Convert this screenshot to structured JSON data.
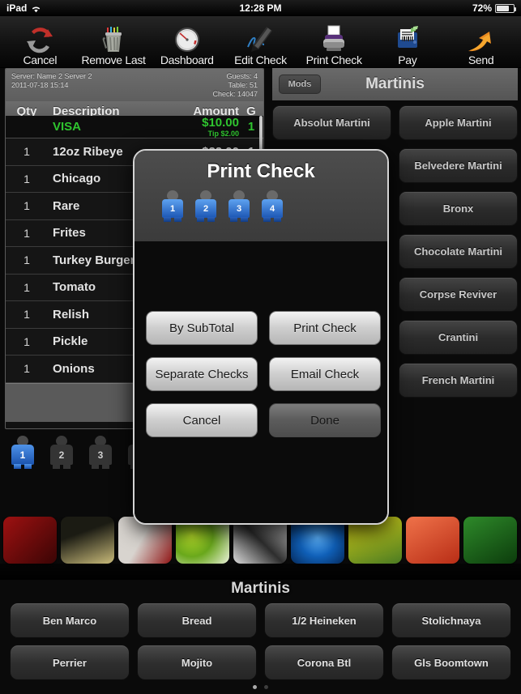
{
  "statusbar": {
    "device": "iPad",
    "wifi_icon": "wifi-icon",
    "time": "12:28 PM",
    "battery_percent": "72%",
    "battery_icon": "battery-icon"
  },
  "toolbar": {
    "items": [
      {
        "label": "Cancel",
        "icon": "cancel-refresh-icon"
      },
      {
        "label": "Remove Last",
        "icon": "trash-can-icon"
      },
      {
        "label": "Dashboard",
        "icon": "gauge-icon"
      },
      {
        "label": "Edit Check",
        "icon": "pen-signature-icon"
      },
      {
        "label": "Print Check",
        "icon": "printer-icon"
      },
      {
        "label": "Pay",
        "icon": "cash-register-icon"
      },
      {
        "label": "Send",
        "icon": "orange-arrow-icon"
      }
    ]
  },
  "check": {
    "server_line": "Server: Name 2 Server 2",
    "datetime": "2011-07-18 15:14",
    "guests_line": "Guests: 4",
    "table_line": "Table: 51",
    "check_line": "Check: 14047",
    "columns": {
      "qty": "Qty",
      "description": "Description",
      "amount": "Amount",
      "g": "G"
    },
    "payment_row": {
      "description": "VISA",
      "amount": "$10.00",
      "tip": "Tip $2.00",
      "g": "1"
    },
    "items": [
      {
        "qty": "1",
        "description": "12oz Ribeye",
        "amount": "$32.00",
        "g": "1"
      },
      {
        "qty": "1",
        "description": "Chicago",
        "amount": "",
        "g": ""
      },
      {
        "qty": "1",
        "description": "Rare",
        "amount": "",
        "g": ""
      },
      {
        "qty": "1",
        "description": "Frites",
        "amount": "",
        "g": ""
      },
      {
        "qty": "1",
        "description": "Turkey Burger",
        "amount": "",
        "g": ""
      },
      {
        "qty": "1",
        "description": "Tomato",
        "amount": "",
        "g": ""
      },
      {
        "qty": "1",
        "description": "Relish",
        "amount": "",
        "g": ""
      },
      {
        "qty": "1",
        "description": "Pickle",
        "amount": "",
        "g": ""
      },
      {
        "qty": "1",
        "description": "Onions",
        "amount": "",
        "g": ""
      }
    ]
  },
  "guest_selector": {
    "guests": [
      "1",
      "2",
      "3",
      "4"
    ],
    "selected": "1",
    "selected_color": "#2f73d0"
  },
  "menu_panel": {
    "mods_label": "Mods",
    "title": "Martinis",
    "left_column": [
      "Absolut Martini"
    ],
    "right_column": [
      "Apple Martini",
      "Belvedere Martini",
      "Bronx",
      "Chocolate Martini",
      "Corpse Reviver",
      "Crantini",
      "French Martini"
    ]
  },
  "carousel": {
    "thumbs": [
      {
        "name": "red-cocktail-thumb",
        "color_a": "#9e1111",
        "color_b": "#3a0505"
      },
      {
        "name": "white-wine-glasses-thumb",
        "color_a": "#1b1b13",
        "color_b": "#c9bb7a"
      },
      {
        "name": "wine-bottle-thumb",
        "color_a": "#d8d4cf",
        "color_b": "#8e1414"
      },
      {
        "name": "green-limes-thumb",
        "color_a": "#e9f0d9",
        "color_b": "#6aa81c"
      },
      {
        "name": "black-white-texture-thumb",
        "color_a": "#d9d9d9",
        "color_b": "#2e2e2e"
      },
      {
        "name": "blue-star-thumb",
        "color_a": "#1060b8",
        "color_b": "#052a5c"
      },
      {
        "name": "yellow-figures-thumb",
        "color_a": "#d8d018",
        "color_b": "#4a7b22"
      },
      {
        "name": "orange-drink-thumb",
        "color_a": "#f0734a",
        "color_b": "#b82d16"
      },
      {
        "name": "green-bottle-thumb",
        "color_a": "#2e8a2a",
        "color_b": "#0c3c0c"
      },
      {
        "name": "amber-beer-thumb",
        "color_a": "#e09a18",
        "color_b": "#8a4a06"
      },
      {
        "name": "brandy-glass-thumb",
        "color_a": "#e7e4df",
        "color_b": "#b35a1c"
      }
    ]
  },
  "bottom_bar": {
    "title": "Martinis",
    "buttons": [
      "Ben Marco",
      "Bread",
      "1/2 Heineken",
      "Stolichnaya",
      "Perrier",
      "Mojito",
      "Corona Btl",
      "Gls Boomtown"
    ],
    "page_dots": 2,
    "active_dot": 0
  },
  "modal": {
    "title": "Print Check",
    "guests": [
      "1",
      "2",
      "3",
      "4"
    ],
    "buttons": [
      {
        "label": "By SubTotal",
        "state": "enabled"
      },
      {
        "label": "Print Check",
        "state": "enabled"
      },
      {
        "label": "Separate Checks",
        "state": "enabled"
      },
      {
        "label": "Email Check",
        "state": "enabled"
      },
      {
        "label": "Cancel",
        "state": "enabled"
      },
      {
        "label": "Done",
        "state": "dim"
      }
    ]
  }
}
